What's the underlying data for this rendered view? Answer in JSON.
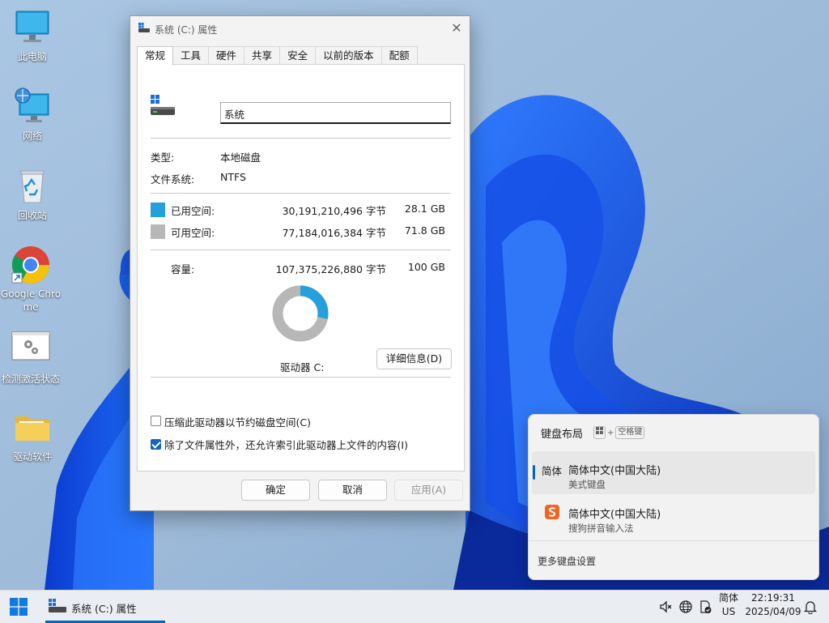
{
  "desktop": {
    "icons": [
      {
        "label": "此电脑",
        "icon": "computer-icon"
      },
      {
        "label": "网络",
        "icon": "network-icon"
      },
      {
        "label": "回收站",
        "icon": "recycle-bin-icon"
      },
      {
        "label": "Google Chrome",
        "icon": "chrome-icon"
      },
      {
        "label": "检测激活状态",
        "icon": "settings-shortcut-icon"
      },
      {
        "label": "驱动软件",
        "icon": "folder-icon"
      }
    ]
  },
  "dialog": {
    "title": "系统 (C:) 属性",
    "close_glyph": "✕",
    "tabs": [
      "常规",
      "工具",
      "硬件",
      "共享",
      "安全",
      "以前的版本",
      "配额"
    ],
    "active_tab": "常规",
    "drive_name": "系统",
    "type_label": "类型:",
    "type_value": "本地磁盘",
    "fs_label": "文件系统:",
    "fs_value": "NTFS",
    "used_label": "已用空间:",
    "used_bytes": "30,191,210,496 字节",
    "used_size": "28.1 GB",
    "free_label": "可用空间:",
    "free_bytes": "77,184,016,384 字节",
    "free_size": "71.8 GB",
    "capacity_label": "容量:",
    "capacity_bytes": "107,375,226,880 字节",
    "capacity_size": "100 GB",
    "used_fraction": 0.281,
    "used_color": "#26a0da",
    "free_color": "#b7b7b7",
    "drive_label": "驱动器 C:",
    "details_button": "详细信息(D)",
    "compress_label": "压缩此驱动器以节约磁盘空间(C)",
    "compress_checked": false,
    "index_label": "除了文件属性外，还允许索引此驱动器上文件的内容(I)",
    "index_checked": true,
    "ok_button": "确定",
    "cancel_button": "取消",
    "apply_button": "应用(A)"
  },
  "flyout": {
    "title": "键盘布局",
    "shortcut_plus": "+",
    "shortcut_key": "空格键",
    "items": [
      {
        "prefix": "简体",
        "name": "简体中文(中国大陆)",
        "sub": "美式键盘",
        "selected": true
      },
      {
        "prefix": "",
        "name": "简体中文(中国大陆)",
        "sub": "搜狗拼音输入法",
        "selected": false,
        "icon": "sogou-icon"
      }
    ],
    "more": "更多键盘设置"
  },
  "taskbar": {
    "app_title": "系统 (C:) 属性",
    "ime_top": "简体",
    "ime_bottom": "US",
    "time": "22:19:31",
    "date": "2025/04/09",
    "accent": "#0067c0"
  }
}
